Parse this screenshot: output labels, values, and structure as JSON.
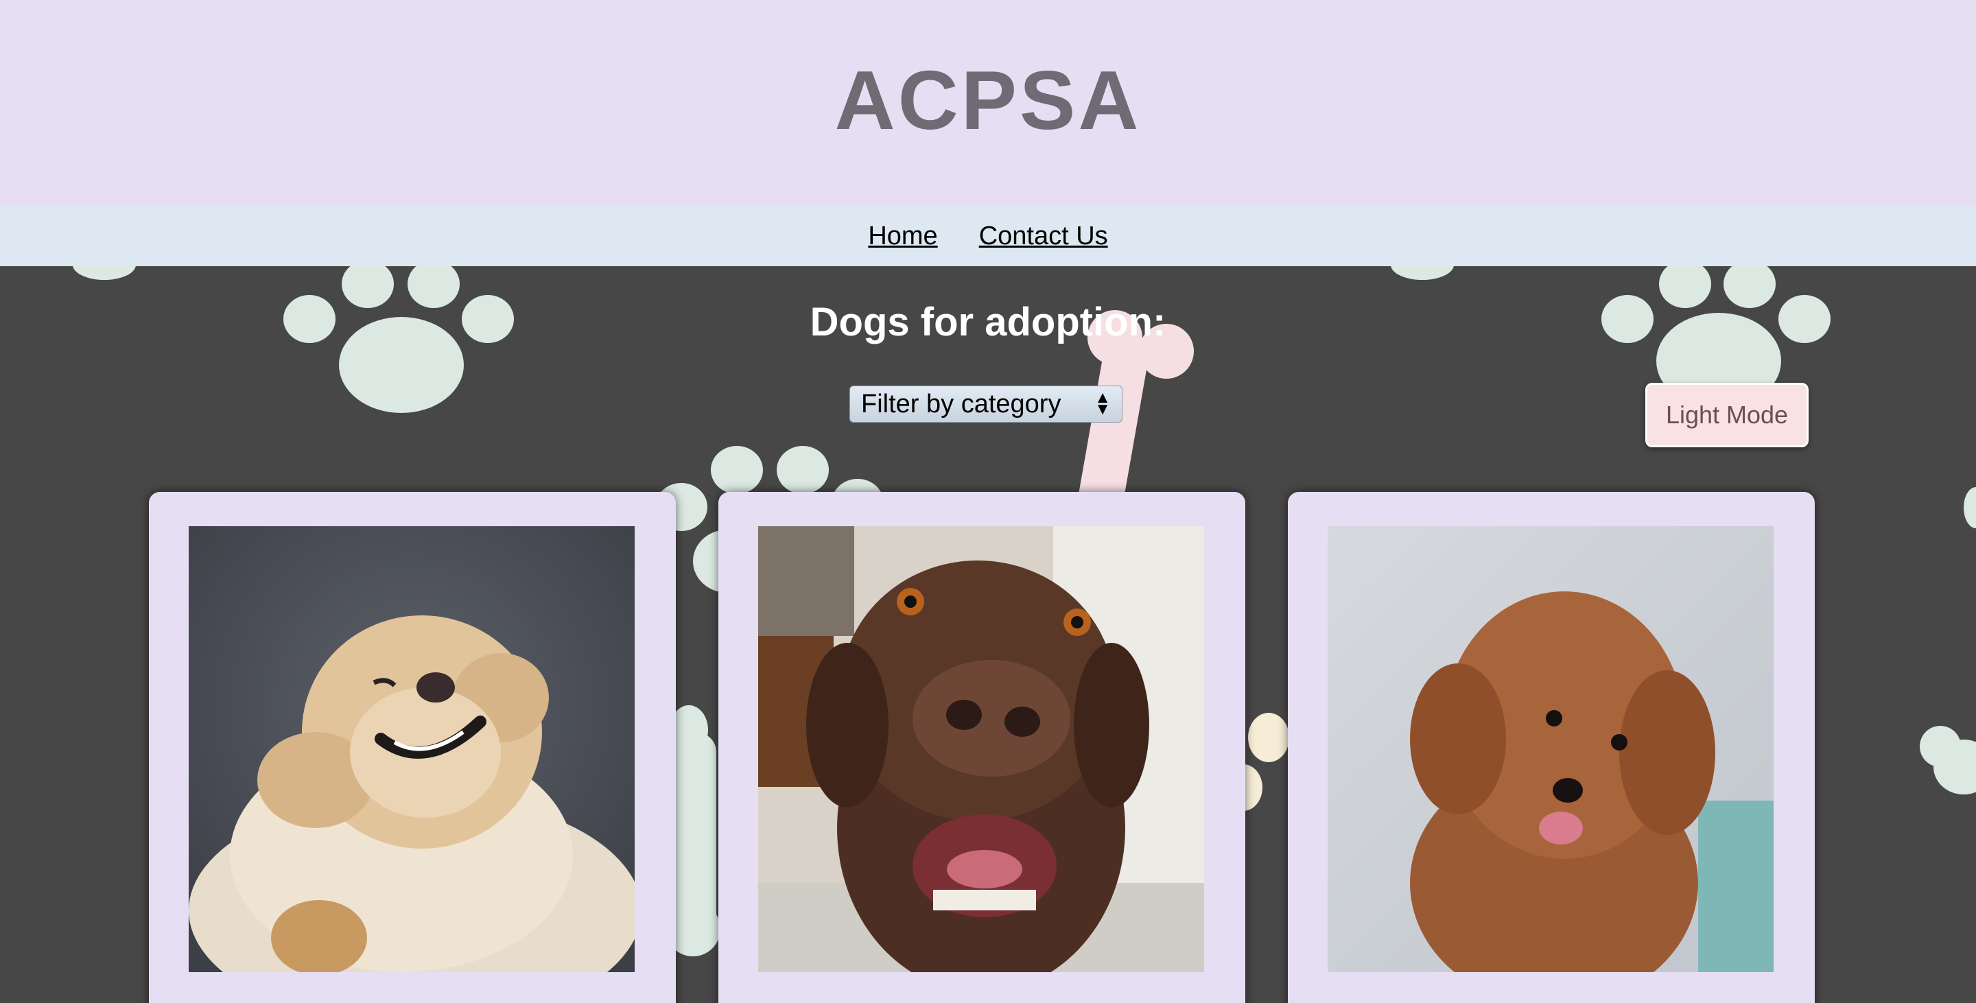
{
  "header": {
    "title": "ACPSA"
  },
  "nav": {
    "links": [
      {
        "label": "Home"
      },
      {
        "label": "Contact Us"
      }
    ]
  },
  "main": {
    "heading": "Dogs for adoption:",
    "filter": {
      "selected": "Filter by category"
    },
    "mode_button": {
      "label": "Light Mode"
    },
    "dogs": [
      {
        "photo": "golden-retriever-photo"
      },
      {
        "photo": "chocolate-labrador-photo"
      },
      {
        "photo": "brown-poodle-photo"
      }
    ]
  },
  "colors": {
    "header_bg": "#e6def3",
    "nav_bg": "#dde8f3",
    "page_bg": "#474747",
    "card_bg": "#e6def3",
    "paw": "#dce9e3",
    "bone": "#f6dfe3",
    "button_bg": "#f8e2e2"
  }
}
